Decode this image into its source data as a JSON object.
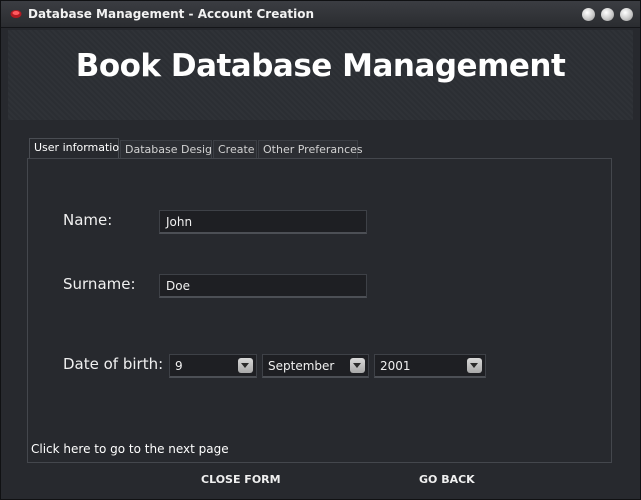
{
  "window": {
    "title": "Database Management - Account Creation",
    "app_icon": "red-database-icon",
    "controls": [
      "minimize-icon",
      "maximize-icon",
      "close-icon"
    ]
  },
  "header": {
    "title": "Book Database Management"
  },
  "tabs": [
    {
      "label": "User information",
      "active": true
    },
    {
      "label": "Database Design",
      "active": false
    },
    {
      "label": "Create",
      "active": false
    },
    {
      "label": "Other Preferances",
      "active": false
    }
  ],
  "form": {
    "name": {
      "label": "Name:",
      "value": "John"
    },
    "surname": {
      "label": "Surname:",
      "value": "Doe"
    },
    "dob": {
      "label": "Date of birth:",
      "day": "9",
      "month": "September",
      "year": "2001"
    }
  },
  "next_link": "Click here to go to the next page",
  "buttons": {
    "close": "CLOSE FORM",
    "back": "GO BACK"
  },
  "colors": {
    "background": "#27292e",
    "titlebar": "#2f3135",
    "accent_icon": "#d0202a"
  }
}
